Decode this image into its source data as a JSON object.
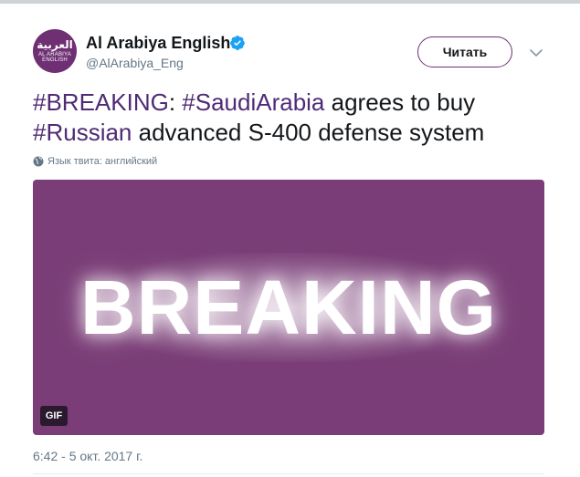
{
  "account": {
    "avatar_arabic": "العربية",
    "avatar_english": "AL ARABIYA ENGLISH",
    "name": "Al Arabiya English",
    "handle": "@AlArabiya_Eng",
    "verified_icon": "verified-badge-icon"
  },
  "actions": {
    "follow_label": "Читать",
    "menu_icon": "chevron-down-icon"
  },
  "tweet": {
    "segments": [
      {
        "text": "#BREAKING",
        "hashtag": true
      },
      {
        "text": ": ",
        "hashtag": false
      },
      {
        "text": "#SaudiArabia",
        "hashtag": true
      },
      {
        "text": " agrees to buy ",
        "hashtag": false
      },
      {
        "text": "#Russian",
        "hashtag": true
      },
      {
        "text": " advanced S-400 defense system",
        "hashtag": false
      }
    ],
    "language_note": "Язык твита: английский",
    "media": {
      "headline": "BREAKING",
      "badge": "GIF",
      "background": "#7a3d77"
    },
    "timestamp": "6:42 - 5 окт. 2017 г."
  },
  "colors": {
    "hashtag": "#4f2a76",
    "brand": "#6e2f73",
    "verified": "#1da1f2",
    "muted": "#657786"
  }
}
